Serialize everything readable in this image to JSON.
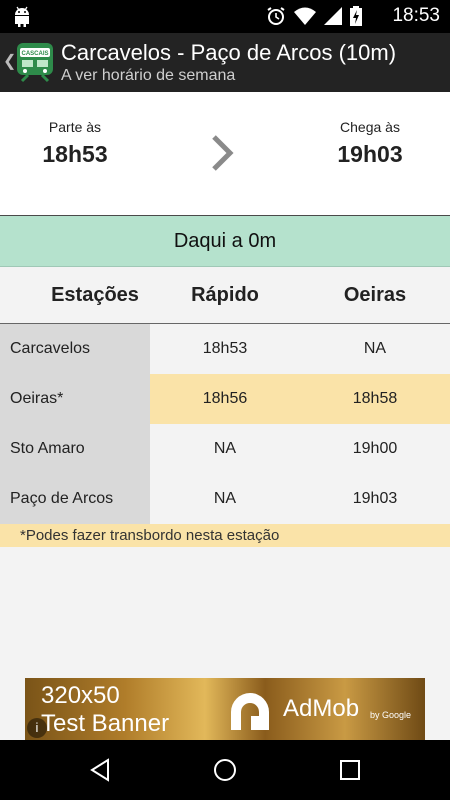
{
  "status_bar": {
    "time": "18:53",
    "icons": [
      "android-icon",
      "alarm-icon",
      "wifi-icon",
      "signal-icon",
      "battery-charging-icon"
    ]
  },
  "action_bar": {
    "app_icon_text": "CASCAIS",
    "title": "Carcavelos - Paço de Arcos (10m)",
    "subtitle": "A ver horário de semana"
  },
  "times": {
    "depart_label": "Parte às",
    "depart_value": "18h53",
    "arrive_label": "Chega às",
    "arrive_value": "19h03"
  },
  "countdown": "Daqui a 0m",
  "table": {
    "headers": [
      "Estações",
      "Rápido",
      "Oeiras"
    ],
    "rows": [
      {
        "station": "Carcavelos",
        "rapido": "18h53",
        "oeiras": "NA"
      },
      {
        "station": "Oeiras*",
        "rapido": "18h56",
        "oeiras": "18h58"
      },
      {
        "station": "Sto Amaro",
        "rapido": "NA",
        "oeiras": "19h00"
      },
      {
        "station": "Paço de Arcos",
        "rapido": "NA",
        "oeiras": "19h03"
      }
    ],
    "footnote": "*Podes fazer transbordo nesta estação"
  },
  "ad": {
    "line1": "320x50",
    "line2": "Test Banner",
    "brand": "AdMob",
    "byline": "by Google",
    "info": "i"
  },
  "colors": {
    "countdown_bg": "#b5e2cd",
    "highlight_bg": "#fae3a8",
    "actionbar_bg": "#232323"
  }
}
